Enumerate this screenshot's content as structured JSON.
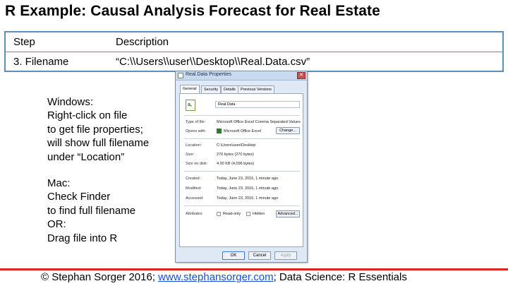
{
  "title": "R Example: Causal Analysis Forecast for Real Estate",
  "table": {
    "headers": [
      "Step",
      "Description"
    ],
    "rows": [
      [
        "3. Filename",
        "“C:\\\\Users\\\\user\\\\Desktop\\\\Real.Data.csv”"
      ]
    ]
  },
  "windows_note": [
    "Windows:",
    "Right-click on file",
    "to get file properties;",
    "will show full filename",
    "under “Location”"
  ],
  "mac_note": [
    "Mac:",
    "Check Finder",
    "to find full filename",
    "OR:",
    "Drag file into R"
  ],
  "dialog": {
    "title": "Real.Data Properties",
    "close_glyph": "✕",
    "tabs": [
      "General",
      "Security",
      "Details",
      "Previous Versions"
    ],
    "file_icon_text": "a,",
    "file_name": "Real.Data",
    "type_label": "Type of file:",
    "type_value": "Microsoft Office Excel Comma Separated Values File",
    "opens_label": "Opens with:",
    "opens_value": "Microsoft Office Excel",
    "change_button": "Change...",
    "location_label": "Location:",
    "location_value": "C:\\Users\\user\\Desktop",
    "size_label": "Size:",
    "size_value": "270 bytes (270 bytes)",
    "size_disk_label": "Size on disk:",
    "size_disk_value": "4.00 KB (4,096 bytes)",
    "created_label": "Created:",
    "created_value": "Today, June 23, 2016, 1 minute ago",
    "modified_label": "Modified:",
    "modified_value": "Today, June 23, 2016, 1 minute ago",
    "accessed_label": "Accessed:",
    "accessed_value": "Today, June 23, 2016, 1 minute ago",
    "attributes_label": "Attributes:",
    "readonly_label": "Read-only",
    "hidden_label": "Hidden",
    "advanced_button": "Advanced...",
    "ok_button": "OK",
    "cancel_button": "Cancel",
    "apply_button": "Apply"
  },
  "footer": {
    "prefix": "© Stephan Sorger 2016; ",
    "link": "www.stephansorger.com",
    "suffix": "; Data Science: R Essentials"
  },
  "colors": {
    "table_border": "#5a8fb4",
    "footer_line": "#e02020",
    "link": "#1a4fd6"
  }
}
